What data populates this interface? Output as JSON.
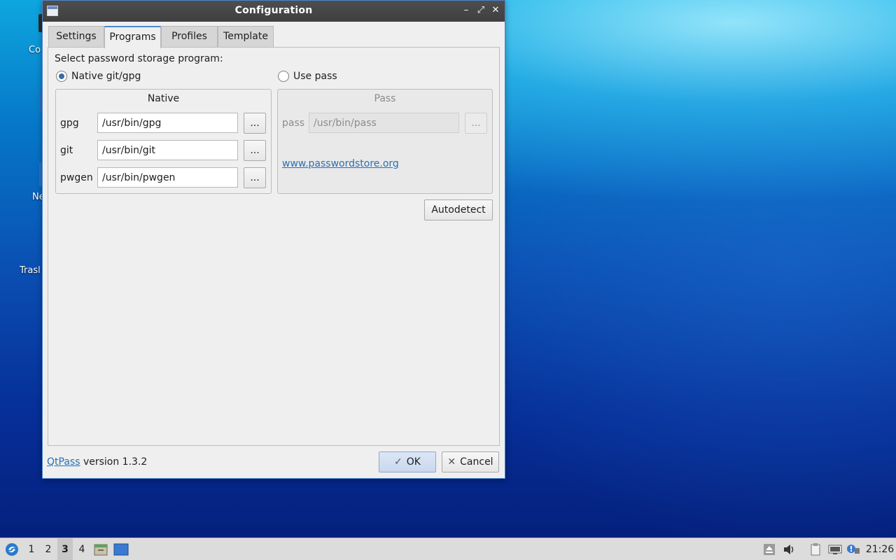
{
  "desktop": {
    "fragments": [
      "Co",
      "Ne",
      "Trasl"
    ]
  },
  "window": {
    "title": "Configuration",
    "controls": {
      "minimize": "–",
      "maximize": "⤢",
      "close": "✕"
    },
    "tabs": [
      {
        "label": "Settings",
        "active": false
      },
      {
        "label": "Programs",
        "active": true
      },
      {
        "label": "Profiles",
        "active": false
      },
      {
        "label": "Template",
        "active": false
      }
    ],
    "programs": {
      "prompt": "Select password storage program:",
      "option_native": "Native git/gpg",
      "option_pass": "Use pass",
      "native": {
        "title": "Native",
        "rows": [
          {
            "label": "gpg",
            "value": "/usr/bin/gpg",
            "browse": "..."
          },
          {
            "label": "git",
            "value": "/usr/bin/git",
            "browse": "..."
          },
          {
            "label": "pwgen",
            "value": "/usr/bin/pwgen",
            "browse": "..."
          }
        ]
      },
      "pass": {
        "title": "Pass",
        "label": "pass",
        "value": "/usr/bin/pass",
        "browse": "...",
        "link": "www.passwordstore.org"
      },
      "autodetect": "Autodetect"
    },
    "footer": {
      "app_link": "QtPass",
      "version_text": " version 1.3.2",
      "ok": "OK",
      "cancel": "Cancel",
      "ok_icon": "✓",
      "cancel_icon": "✕"
    }
  },
  "taskbar": {
    "workspaces": [
      "1",
      "2",
      "3",
      "4"
    ],
    "active_workspace": "3",
    "clock": "21:26"
  }
}
